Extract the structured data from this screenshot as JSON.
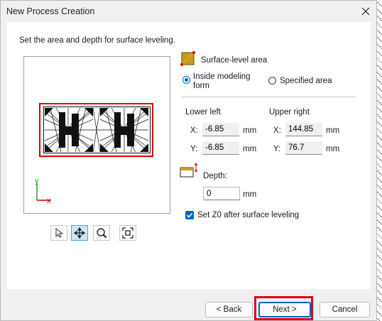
{
  "window": {
    "title": "New Process Creation"
  },
  "instruction": "Set the area and depth for surface leveling.",
  "preview": {
    "axis_y": "y",
    "axis_x": "x"
  },
  "tools": [
    "pointer-icon",
    "pan-icon",
    "zoom-icon",
    "fit-icon"
  ],
  "surface_area": {
    "heading": "Surface-level area",
    "option_inside": "Inside modeling form",
    "option_inside_line1": "Inside modeling",
    "option_inside_line2": "form",
    "option_specified": "Specified area",
    "selected": "inside"
  },
  "lower_left": {
    "heading": "Lower left",
    "x_label": "X:",
    "x_value": "-6.85",
    "y_label": "Y:",
    "y_value": "-6.85"
  },
  "upper_right": {
    "heading": "Upper right",
    "x_label": "X:",
    "x_value": "144.85",
    "y_label": "Y:",
    "y_value": "76.7"
  },
  "unit": "mm",
  "depth": {
    "label": "Depth:",
    "value": "0",
    "unit": "mm"
  },
  "set_z0": {
    "label": "Set Z0 after surface leveling",
    "checked": true
  },
  "buttons": {
    "back": "< Back",
    "next": "Next >",
    "cancel": "Cancel"
  },
  "colors": {
    "highlight": "#e0001a",
    "accent": "#0067c0"
  }
}
